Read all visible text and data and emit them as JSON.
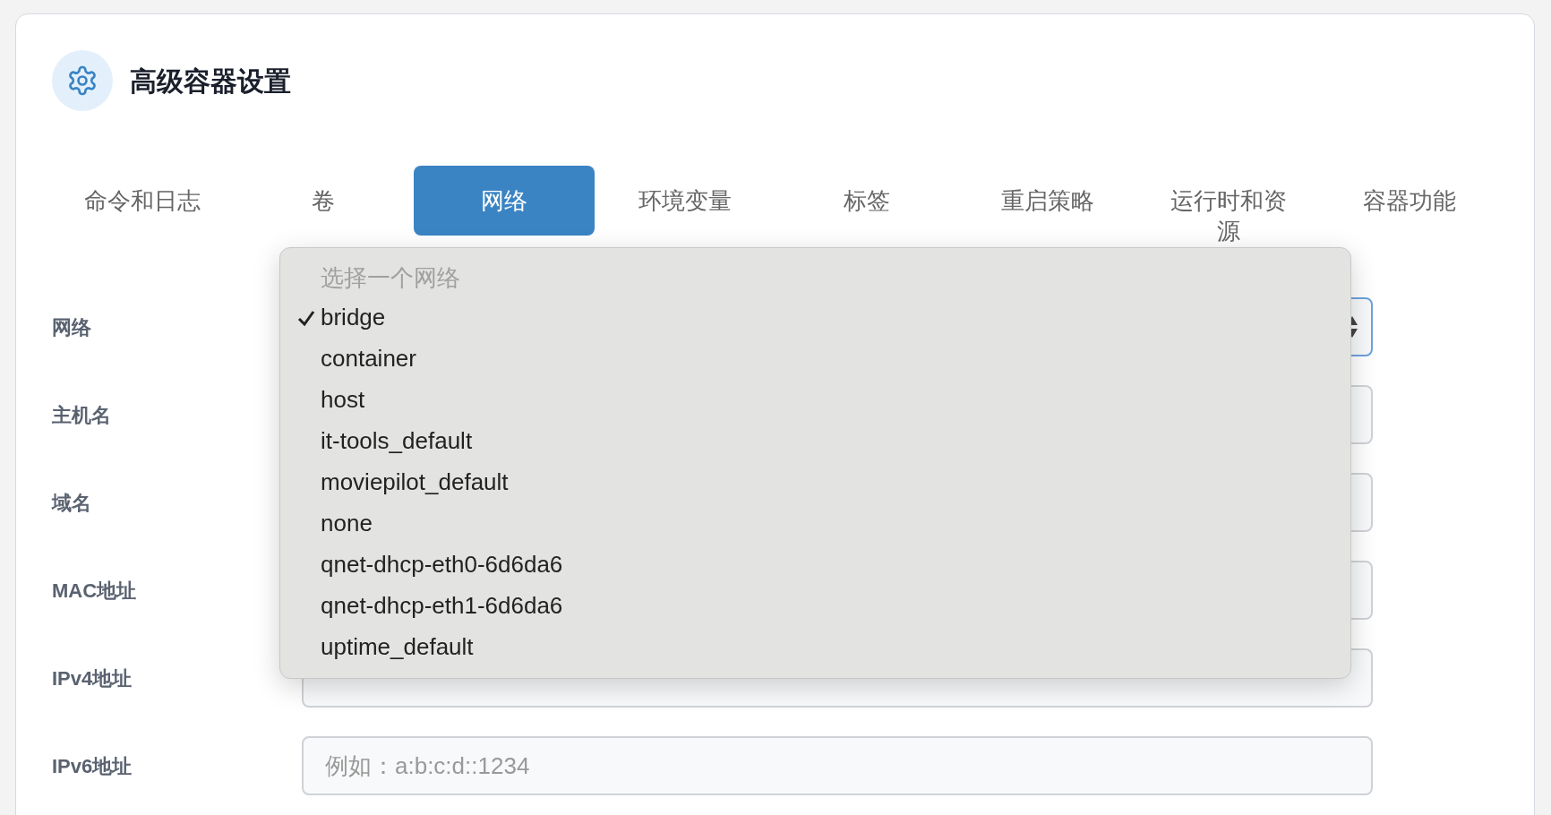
{
  "title": "高级容器设置",
  "tabs": [
    {
      "label": "命令和日志",
      "selected": false
    },
    {
      "label": "卷",
      "selected": false
    },
    {
      "label": "网络",
      "selected": true
    },
    {
      "label": "环境变量",
      "selected": false
    },
    {
      "label": "标签",
      "selected": false
    },
    {
      "label": "重启策略",
      "selected": false
    },
    {
      "label": "运行时和资源",
      "selected": false
    },
    {
      "label": "容器功能",
      "selected": false
    }
  ],
  "fields": [
    {
      "label": "网络",
      "kind": "select"
    },
    {
      "label": "主机名",
      "kind": "input"
    },
    {
      "label": "域名",
      "kind": "input"
    },
    {
      "label": "MAC地址",
      "kind": "input"
    },
    {
      "label": "IPv4地址",
      "kind": "input"
    },
    {
      "label": "IPv6地址",
      "kind": "input",
      "placeholder": "例如：a:b:c:d::1234"
    }
  ],
  "dropdown": {
    "placeholder": "选择一个网络",
    "options": [
      {
        "label": "bridge",
        "selected": true
      },
      {
        "label": "container",
        "selected": false
      },
      {
        "label": "host",
        "selected": false
      },
      {
        "label": "it-tools_default",
        "selected": false
      },
      {
        "label": "moviepilot_default",
        "selected": false
      },
      {
        "label": "none",
        "selected": false
      },
      {
        "label": "qnet-dhcp-eth0-6d6da6",
        "selected": false
      },
      {
        "label": "qnet-dhcp-eth1-6d6da6",
        "selected": false
      },
      {
        "label": "uptime_default",
        "selected": false
      }
    ]
  }
}
